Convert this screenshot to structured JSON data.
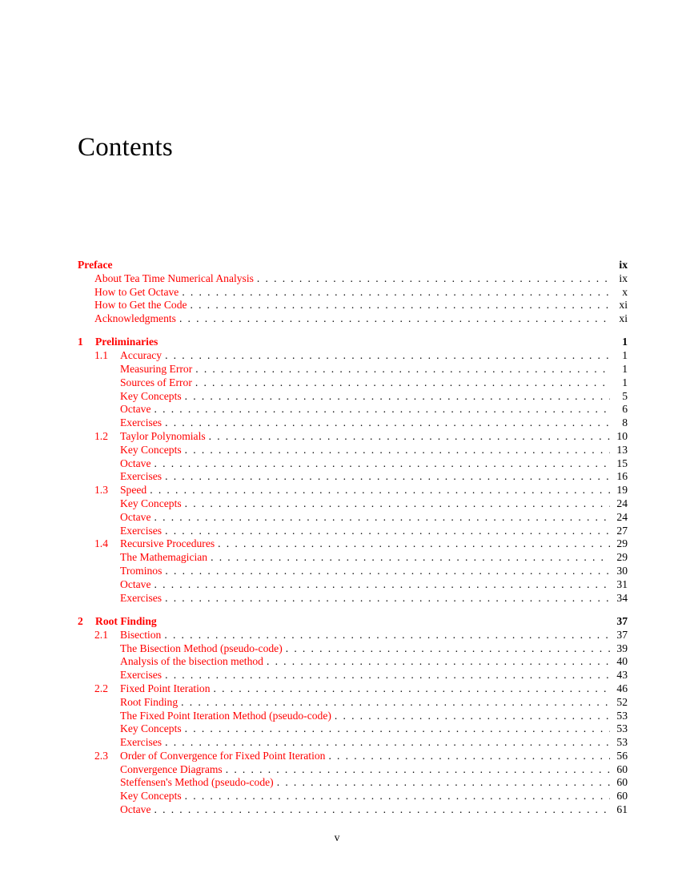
{
  "title": "Contents",
  "preface": {
    "label": "Preface",
    "page": "ix",
    "items": [
      {
        "label": "About Tea Time Numerical Analysis",
        "page": "ix"
      },
      {
        "label": "How to Get Octave",
        "page": "x"
      },
      {
        "label": "How to Get the Code",
        "page": "xi"
      },
      {
        "label": "Acknowledgments",
        "page": "xi"
      }
    ]
  },
  "chapters": [
    {
      "num": "1",
      "label": "Preliminaries",
      "page": "1",
      "sections": [
        {
          "num": "1.1",
          "label": "Accuracy",
          "page": "1",
          "items": [
            {
              "label": "Measuring Error",
              "page": "1"
            },
            {
              "label": "Sources of Error",
              "page": "1"
            },
            {
              "label": "Key Concepts",
              "page": "5"
            },
            {
              "label": "Octave",
              "page": "6"
            },
            {
              "label": "Exercises",
              "page": "8"
            }
          ]
        },
        {
          "num": "1.2",
          "label": "Taylor Polynomials",
          "page": "10",
          "items": [
            {
              "label": "Key Concepts",
              "page": "13"
            },
            {
              "label": "Octave",
              "page": "15"
            },
            {
              "label": "Exercises",
              "page": "16"
            }
          ]
        },
        {
          "num": "1.3",
          "label": "Speed",
          "page": "19",
          "items": [
            {
              "label": "Key Concepts",
              "page": "24"
            },
            {
              "label": "Octave",
              "page": "24"
            },
            {
              "label": "Exercises",
              "page": "27"
            }
          ]
        },
        {
          "num": "1.4",
          "label": "Recursive Procedures",
          "page": "29",
          "items": [
            {
              "label": "The Mathemagician",
              "page": "29"
            },
            {
              "label": "Trominos",
              "page": "30"
            },
            {
              "label": "Octave",
              "page": "31"
            },
            {
              "label": "Exercises",
              "page": "34"
            }
          ]
        }
      ]
    },
    {
      "num": "2",
      "label": "Root Finding",
      "page": "37",
      "sections": [
        {
          "num": "2.1",
          "label": "Bisection",
          "page": "37",
          "items": [
            {
              "label": "The Bisection Method (pseudo-code)",
              "page": "39"
            },
            {
              "label": "Analysis of the bisection method",
              "page": "40"
            },
            {
              "label": "Exercises",
              "page": "43"
            }
          ]
        },
        {
          "num": "2.2",
          "label": "Fixed Point Iteration",
          "page": "46",
          "items": [
            {
              "label": "Root Finding",
              "page": "52"
            },
            {
              "label": "The Fixed Point Iteration Method (pseudo-code)",
              "page": "53"
            },
            {
              "label": "Key Concepts",
              "page": "53"
            },
            {
              "label": "Exercises",
              "page": "53"
            }
          ]
        },
        {
          "num": "2.3",
          "label": "Order of Convergence for Fixed Point Iteration",
          "page": "56",
          "items": [
            {
              "label": "Convergence Diagrams",
              "page": "60"
            },
            {
              "label": "Steffensen's Method (pseudo-code)",
              "page": "60"
            },
            {
              "label": "Key Concepts",
              "page": "60"
            },
            {
              "label": "Octave",
              "page": "61"
            }
          ]
        }
      ]
    }
  ],
  "footer": {
    "page_number": "v"
  }
}
